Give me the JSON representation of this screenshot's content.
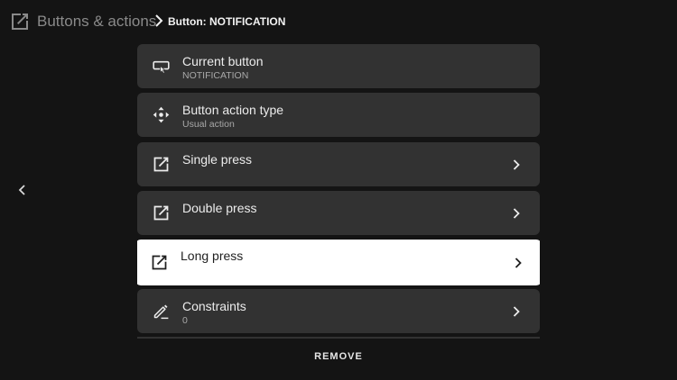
{
  "header": {
    "title": "Buttons & actions",
    "breadcrumb": "Button: NOTIFICATION"
  },
  "items": [
    {
      "label": "Current button",
      "subtitle": "NOTIFICATION",
      "icon": "remote-button-icon",
      "has_chevron": false,
      "focused": false
    },
    {
      "label": "Button action type",
      "subtitle": "Usual action",
      "icon": "move-arrows-icon",
      "has_chevron": false,
      "focused": false
    },
    {
      "label": "Single press",
      "subtitle": "",
      "icon": "open-external-icon",
      "has_chevron": true,
      "focused": false
    },
    {
      "label": "Double press",
      "subtitle": "",
      "icon": "open-external-icon",
      "has_chevron": true,
      "focused": false
    },
    {
      "label": "Long press",
      "subtitle": "",
      "icon": "open-external-icon",
      "has_chevron": true,
      "focused": true
    },
    {
      "label": "Constraints",
      "subtitle": "0",
      "icon": "pencil-icon",
      "has_chevron": true,
      "focused": false
    }
  ],
  "actions": {
    "remove_label": "REMOVE"
  },
  "colors": {
    "background": "#141414",
    "card": "#323232",
    "card_focused": "#ffffff",
    "text_primary": "#ececec",
    "text_secondary": "#a9a9a9"
  }
}
